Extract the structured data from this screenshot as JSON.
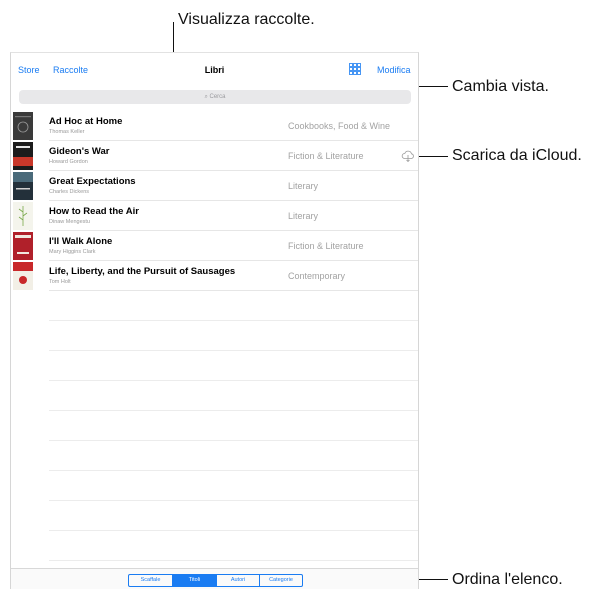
{
  "callouts": {
    "collections": "Visualizza raccolte.",
    "view": "Cambia vista.",
    "icloud": "Scarica da iCloud.",
    "sort": "Ordina l'elenco."
  },
  "navbar": {
    "store": "Store",
    "collections": "Raccolte",
    "title": "Libri",
    "edit": "Modifica",
    "view_icon": "grid-view-icon"
  },
  "search": {
    "placeholder": "Cerca"
  },
  "books": [
    {
      "title": "Ad Hoc at Home",
      "author": "Thomas Keller",
      "category": "Cookbooks, Food & Wine"
    },
    {
      "title": "Gideon's War",
      "author": "Howard Gordon",
      "category": "Fiction & Literature",
      "icon": "icloud-download-icon"
    },
    {
      "title": "Great Expectations",
      "author": "Charles Dickens",
      "category": "Literary"
    },
    {
      "title": "How to Read the Air",
      "author": "Dinaw Mengestu",
      "category": "Literary"
    },
    {
      "title": "I'll Walk Alone",
      "author": "Mary Higgins Clark",
      "category": "Fiction & Literature"
    },
    {
      "title": "Life, Liberty, and the Pursuit of Sausages",
      "author": "Tom Holt",
      "category": "Contemporary"
    }
  ],
  "sort": {
    "options": [
      "Scaffale",
      "Titoli",
      "Autori",
      "Categorie"
    ],
    "selected": "Titoli"
  },
  "colors": {
    "accent": "#1a7cf2",
    "separator": "#e6e6e6"
  }
}
